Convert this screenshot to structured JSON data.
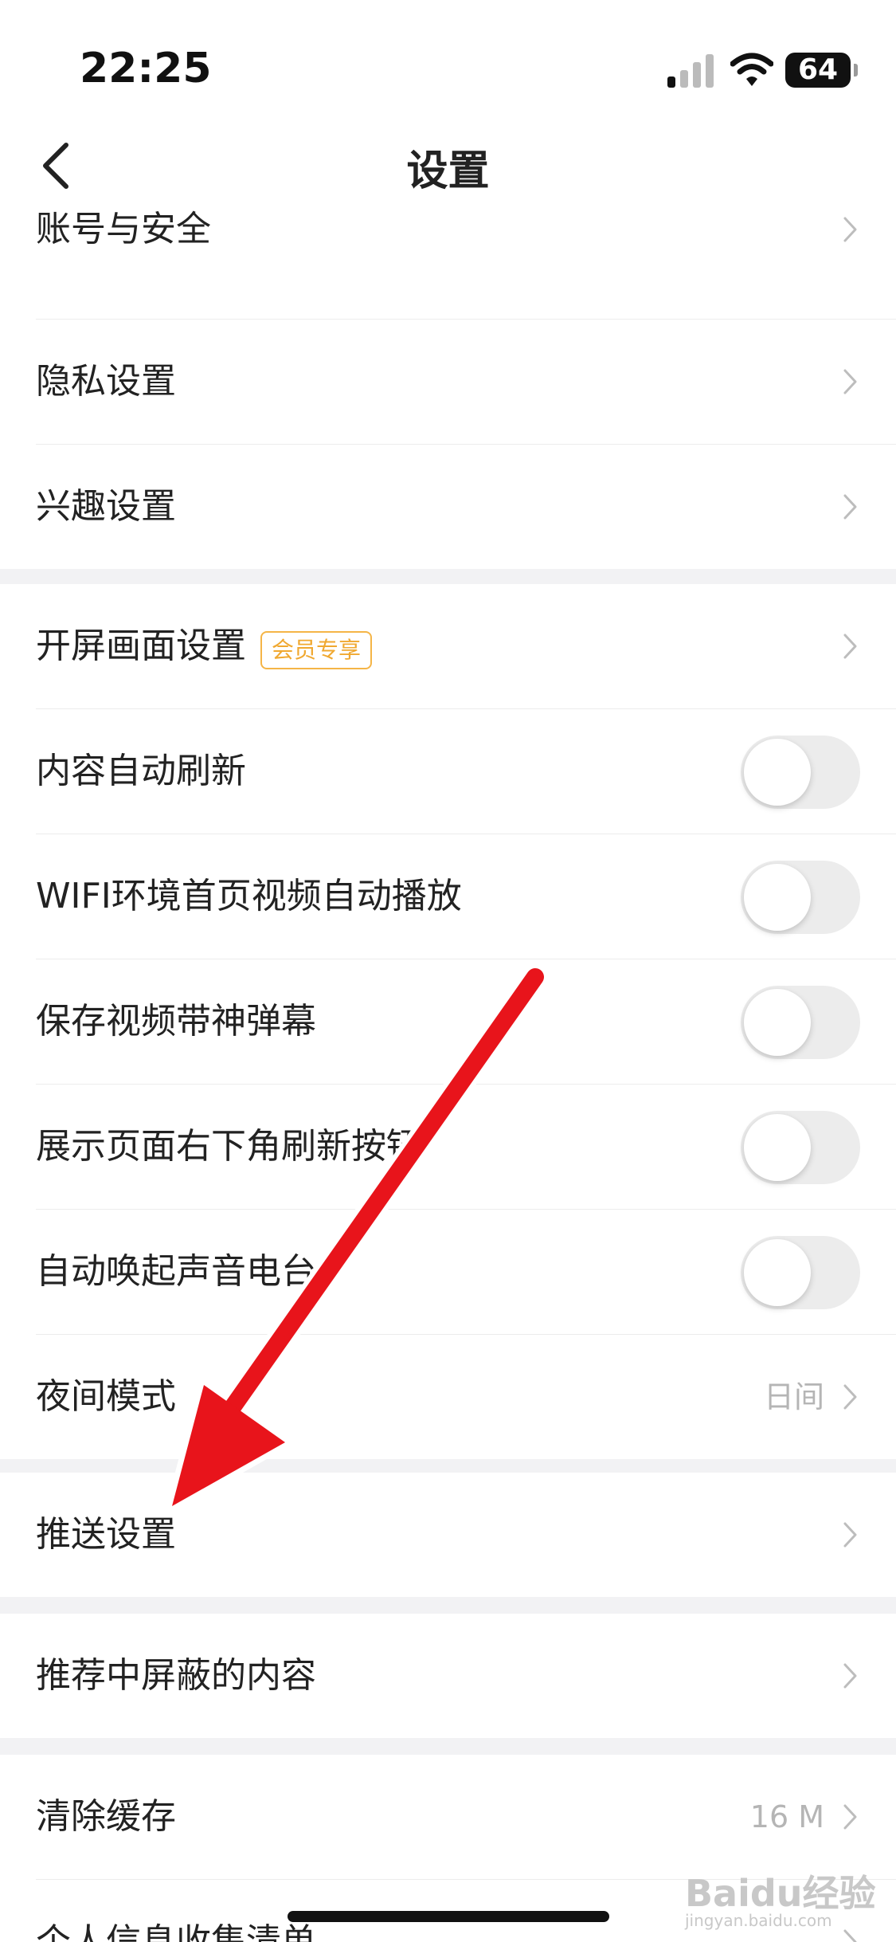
{
  "status_bar": {
    "time": "22:25",
    "battery": "64"
  },
  "header": {
    "title": "设置"
  },
  "groups": [
    {
      "items": [
        {
          "label": "账号与安全"
        },
        {
          "label": "隐私设置"
        },
        {
          "label": "兴趣设置"
        }
      ]
    },
    {
      "items": [
        {
          "label": "开屏画面设置",
          "badge": "会员专享"
        },
        {
          "label": "内容自动刷新",
          "toggle": false
        },
        {
          "label": "WIFI环境首页视频自动播放",
          "toggle": false
        },
        {
          "label": "保存视频带神弹幕",
          "toggle": false
        },
        {
          "label": "展示页面右下角刷新按钮",
          "toggle": false
        },
        {
          "label": "自动唤起声音电台",
          "toggle": false
        },
        {
          "label": "夜间模式",
          "value": "日间"
        }
      ]
    },
    {
      "items": [
        {
          "label": "推送设置"
        }
      ]
    },
    {
      "items": [
        {
          "label": "推荐中屏蔽的内容"
        }
      ]
    },
    {
      "items": [
        {
          "label": "清除缓存",
          "value": "16 M"
        },
        {
          "label": "个人信息收集清单"
        }
      ]
    }
  ],
  "watermark": {
    "brand": "Baidu经验",
    "url": "jingyan.baidu.com"
  },
  "colors": {
    "badge": "#f0a830",
    "arrow": "#e8141b",
    "separator": "#f2f2f4"
  }
}
